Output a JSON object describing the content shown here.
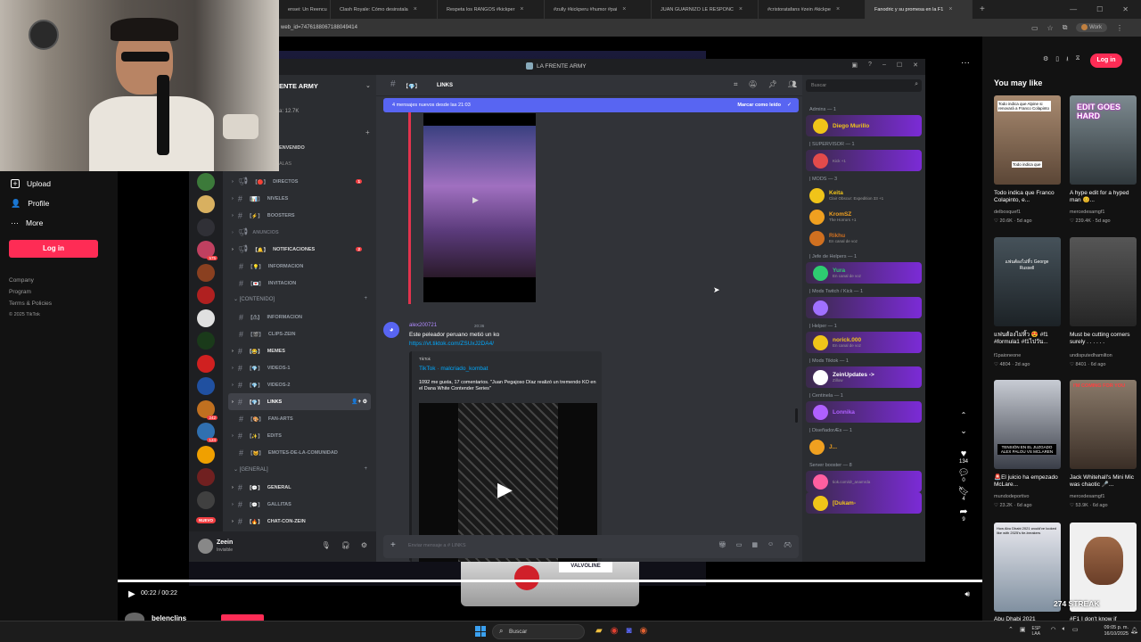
{
  "browser": {
    "tabs": [
      {
        "label": "ensei: Un Reencu"
      },
      {
        "label": "Clash Royale: Cómo desinstala"
      },
      {
        "label": "Respeta los RANGOS #kickper"
      },
      {
        "label": "#zully #kickperu #humor #pai"
      },
      {
        "label": "JUAN GUARNIZO LE RESPONC"
      },
      {
        "label": "#cristoratafans #zein #kickpe"
      },
      {
        "label": "Fanodric y su promesa en la F1",
        "active": true
      }
    ],
    "url": "web_id=7476188067188049414",
    "profile_label": "Work"
  },
  "tiktok": {
    "nav": [
      {
        "label": "Upload",
        "icon": "upload-icon"
      },
      {
        "label": "Profile",
        "icon": "person-icon"
      },
      {
        "label": "More",
        "icon": "more-icon"
      }
    ],
    "login_label": "Log in",
    "footer": [
      "Company",
      "Program",
      "Terms & Policies",
      "© 2025 TikTok"
    ],
    "header_login": "Log in",
    "you_may_like": "You may like",
    "player_time": "00:22 / 00:22",
    "author": "belenclins",
    "actions": [
      {
        "icon": "heart-icon",
        "count": "134"
      },
      {
        "icon": "comment-icon",
        "count": "0"
      },
      {
        "icon": "bookmark-icon",
        "count": "4"
      },
      {
        "icon": "share-icon",
        "count": "9"
      }
    ],
    "feed": [
      {
        "title": "Todo indica que Franco Colapinto, e...",
        "author": "delbosquef1",
        "views": "20.6K",
        "age": "5d ago",
        "overlay": "Todo indica que"
      },
      {
        "title": "A hype edit for a hyped man 😊...",
        "author": "mercedesamgf1",
        "views": "239.4K",
        "age": "5d ago",
        "overlay": "EDIT GOES HARD"
      },
      {
        "title": "แฟนต้องไม่ทิ้ว 😍 #f1 #formula1 #f1ไปวัน...",
        "author": "f1paioneone",
        "views": "4804",
        "age": "2d ago",
        "overlay": "แฟนต้องไม่ทิ้ว George Russell"
      },
      {
        "title": "Must be cutting corners surely . . . . . .",
        "author": "undisputedhamilton",
        "views": "8401",
        "age": "6d ago",
        "overlay": ""
      },
      {
        "title": "🚨El juicio ha empezado McLare...",
        "author": "mundodeportivo",
        "views": "23.2K",
        "age": "6d ago",
        "overlay": "TENSIÓN EN EL JUZGADO ALEX PALOU VS MCLAREN"
      },
      {
        "title": "Jack Whitehall's Mini Mic was chaotic 🎤...",
        "author": "mercedesamgf1",
        "views": "53.9K",
        "age": "6d ago",
        "overlay": "I'M COMING FOR YOU"
      },
      {
        "title": "Abu Dhabi 2021",
        "author": "",
        "views": "",
        "age": "",
        "overlay": "How Abu Dhabi 2021 would've looked like with 2025's tie-breakers"
      },
      {
        "title": "#F1 I don't know if",
        "author": "",
        "views": "",
        "age": "",
        "overlay": ""
      }
    ],
    "streak": "274 STREAK"
  },
  "discord": {
    "window_title": "LA FRENTE ARMY",
    "server_name": "ENTE ARMY",
    "member_count": "a: 12.7K",
    "search_placeholder": "Buscar",
    "channel_header": "LINKS",
    "new_messages": "4 mensajes nuevos desde las 21:03",
    "mark_read": "Marcar como leído",
    "categories": [
      {
        "label": "[CONTENIDO]"
      },
      {
        "label": "[GENERAL]"
      }
    ],
    "channels_top": [
      {
        "label": "DIRECTOS",
        "badge": "1"
      },
      {
        "label": "NIVELES",
        "badge": ""
      },
      {
        "label": "BOOSTERS",
        "badge": ""
      },
      {
        "label": "ANUNCIOS",
        "badge": ""
      },
      {
        "label": "NOTIFICACIONES",
        "badge": "2"
      },
      {
        "label": "INFORMACION",
        "badge": ""
      },
      {
        "label": "INVITACION",
        "badge": ""
      }
    ],
    "channels_content": [
      {
        "label": "INFORMACION"
      },
      {
        "label": "CLIPS-ZEIN"
      },
      {
        "label": "MEMES"
      },
      {
        "label": "VIDEOS-1"
      },
      {
        "label": "VIDEOS-2"
      },
      {
        "label": "LINKS",
        "selected": true
      },
      {
        "label": "FAN-ARTS"
      },
      {
        "label": "EDITS"
      },
      {
        "label": "EMOTES-DE-LA-COMUNIDAD"
      }
    ],
    "channels_general": [
      {
        "label": "GENERAL"
      },
      {
        "label": "GALLITAS"
      },
      {
        "label": "CHAT-CON-ZEIN"
      }
    ],
    "misc_labels": {
      "venvenido": "ENVENIDO",
      "salas": "ALAS"
    },
    "user": {
      "name": "Zeein",
      "status": "Invisible"
    },
    "message": {
      "author": "alex200721",
      "time": "20:36",
      "text": "Este peleador peruano metió un ko",
      "link": "https://vt.tiktok.com/ZSUxJ2DA4/",
      "embed_provider": "TikTok",
      "embed_title": "TikTok · malcriado_kombat",
      "embed_desc": "1092 me gusta, 17 comentarios. \"Juan Pegajoso Díaz realizó un tremendo KO en el Dana White Contender Series\""
    },
    "composer_placeholder": "Enviar mensaje a # LINKS",
    "member_groups": [
      {
        "title": "Admins — 1",
        "members": [
          {
            "name": "Diego Murillo",
            "sub": "",
            "color": "#f0c419",
            "banner": true
          }
        ]
      },
      {
        "title": "| SUPERVISOR — 1",
        "members": [
          {
            "name": "",
            "sub": "Kick +1",
            "color": "#e24b4b",
            "banner": true
          }
        ]
      },
      {
        "title": "| MODS — 3",
        "members": [
          {
            "name": "Keita",
            "sub": "Clair Obscur: Expedition 33 +1",
            "color": "#f0c419",
            "banner": false
          },
          {
            "name": "KromSZ",
            "sub": "The Horrors +1",
            "color": "#f0a020",
            "banner": false
          },
          {
            "name": "Rikhu",
            "sub": "En canal de voz",
            "color": "#d07020",
            "banner": false
          }
        ]
      },
      {
        "title": "| Jefe de Helpers — 1",
        "members": [
          {
            "name": "Yura",
            "sub": "En canal de voz",
            "color": "#2ecc71",
            "banner": true
          }
        ]
      },
      {
        "title": "| Mods Twitch / Kick — 1",
        "members": [
          {
            "name": "",
            "sub": "",
            "color": "#a070ff",
            "banner": true
          }
        ]
      },
      {
        "title": "| Helper — 1",
        "members": [
          {
            "name": "norick.000",
            "sub": "En canal de voz",
            "color": "#f0c419",
            "banner": true
          }
        ]
      },
      {
        "title": "| Mods Tiktok — 1",
        "members": [
          {
            "name": "ZeinUpdates ->",
            "sub": "Zillow",
            "color": "#ffffff",
            "banner": true
          }
        ]
      },
      {
        "title": "| Centinela — 1",
        "members": [
          {
            "name": "Lonnika",
            "sub": "",
            "color": "#b060ff",
            "banner": true
          }
        ]
      },
      {
        "title": "| DiseñadorÆs — 1",
        "members": [
          {
            "name": "J...",
            "sub": "",
            "color": "#f0a020",
            "banner": false
          }
        ]
      },
      {
        "title": "Server booster — 8",
        "members": [
          {
            "name": "",
            "sub": "tiok.com/dr_anamrda",
            "color": "#ff5fa0",
            "banner": true
          },
          {
            "name": "[Dukam-",
            "sub": "",
            "color": "#f0c419",
            "banner": true
          }
        ]
      }
    ]
  },
  "taskbar": {
    "search": "Buscar",
    "lang": "ESP LAA",
    "time": "09:05 p. m.",
    "date": "16/10/2025"
  }
}
